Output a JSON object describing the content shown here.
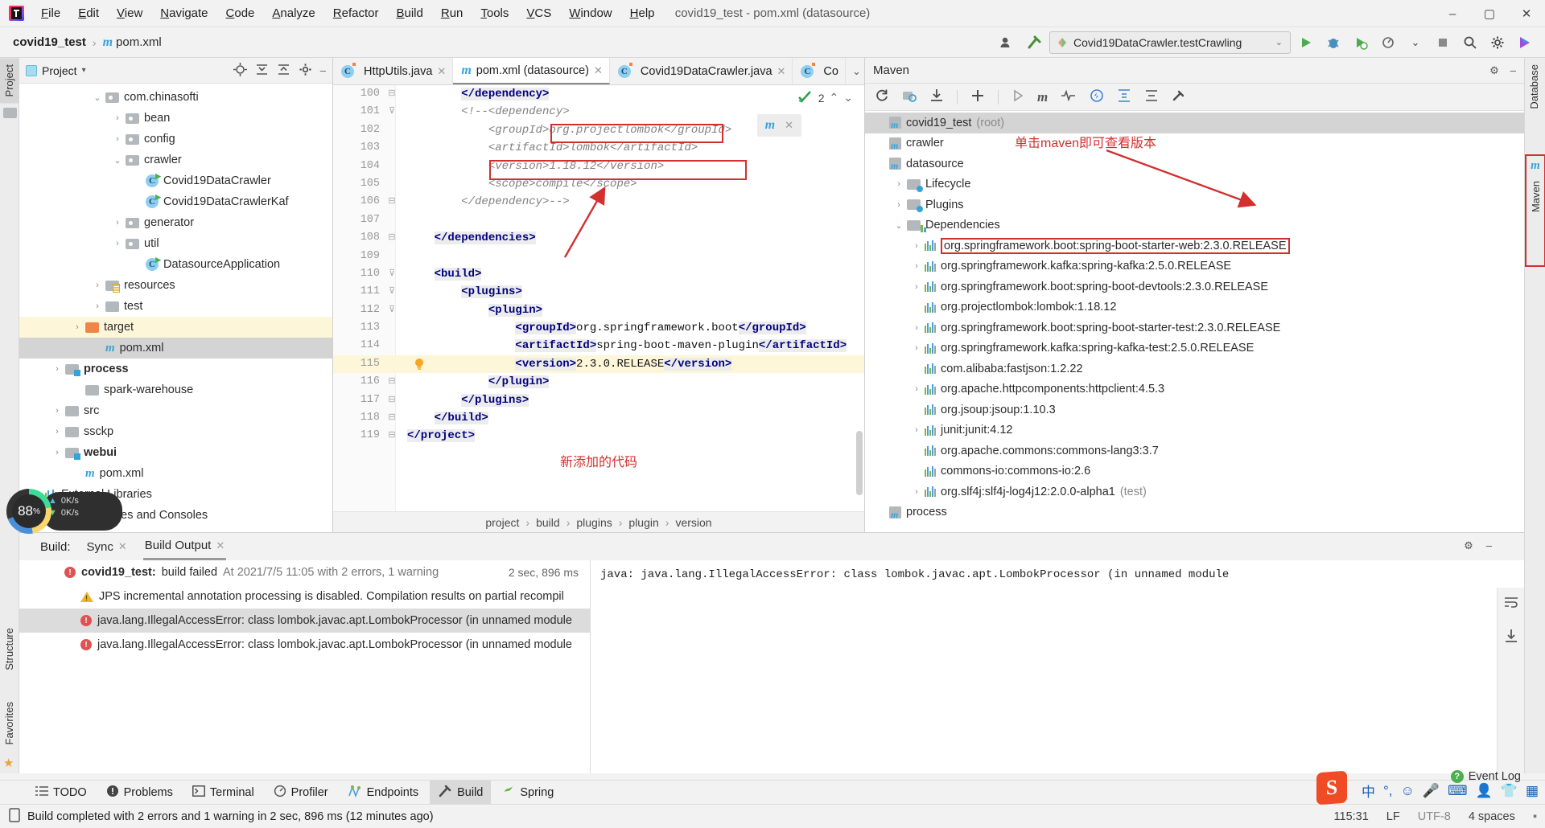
{
  "window": {
    "title": "covid19_test - pom.xml (datasource)",
    "minimize": "–",
    "maximize": "▢",
    "close": "✕"
  },
  "menu": [
    "File",
    "Edit",
    "View",
    "Navigate",
    "Code",
    "Analyze",
    "Refactor",
    "Build",
    "Run",
    "Tools",
    "VCS",
    "Window",
    "Help"
  ],
  "navbar": {
    "project": "covid19_test",
    "separator": "›",
    "file": "pom.xml",
    "run_config": "Covid19DataCrawler.testCrawling",
    "chevron": "⌄"
  },
  "left_strip": {
    "project_tab": "Project",
    "structure_tab": "Structure",
    "favorites_tab": "Favorites"
  },
  "right_strip": {
    "database_tab": "Database",
    "maven_tab": "Maven"
  },
  "project_panel": {
    "title": "Project",
    "dropdown": "▾",
    "tree": [
      {
        "label": "com.chinasofti",
        "type": "folder",
        "arrow": "⌄",
        "indent": 3
      },
      {
        "label": "bean",
        "type": "folder",
        "arrow": "›",
        "indent": 4
      },
      {
        "label": "config",
        "type": "folder",
        "arrow": "›",
        "indent": 4
      },
      {
        "label": "crawler",
        "type": "folder",
        "arrow": "⌄",
        "indent": 4
      },
      {
        "label": "Covid19DataCrawler",
        "type": "class",
        "arrow": "",
        "indent": 5
      },
      {
        "label": "Covid19DataCrawlerKaf",
        "type": "class",
        "arrow": "",
        "indent": 5
      },
      {
        "label": "generator",
        "type": "folder",
        "arrow": "›",
        "indent": 4
      },
      {
        "label": "util",
        "type": "folder",
        "arrow": "›",
        "indent": 4
      },
      {
        "label": "DatasourceApplication",
        "type": "class-app",
        "arrow": "",
        "indent": 5
      },
      {
        "label": "resources",
        "type": "folder-res",
        "arrow": "›",
        "indent": 3
      },
      {
        "label": "test",
        "type": "folder-plain",
        "arrow": "›",
        "indent": 3
      },
      {
        "label": "target",
        "type": "folder-orange",
        "arrow": "›",
        "indent": 2,
        "state": "hl"
      },
      {
        "label": "pom.xml",
        "type": "maven",
        "arrow": "",
        "indent": 3,
        "state": "sel"
      },
      {
        "label": "process",
        "type": "folder-mod",
        "arrow": "›",
        "indent": 1,
        "bold": true
      },
      {
        "label": "spark-warehouse",
        "type": "folder-plain",
        "arrow": "",
        "indent": 2
      },
      {
        "label": "src",
        "type": "folder-plain",
        "arrow": "›",
        "indent": 1
      },
      {
        "label": "ssckp",
        "type": "folder-plain",
        "arrow": "›",
        "indent": 1
      },
      {
        "label": "webui",
        "type": "folder-mod",
        "arrow": "›",
        "indent": 1,
        "bold": true
      },
      {
        "label": "pom.xml",
        "type": "maven",
        "arrow": "",
        "indent": 2
      },
      {
        "label": "External Libraries",
        "type": "bars",
        "arrow": "›",
        "indent": 0
      },
      {
        "label": "Scratches and Consoles",
        "type": "bars",
        "arrow": "",
        "indent": 1
      }
    ]
  },
  "editor": {
    "tabs": [
      {
        "label": "HttpUtils.java",
        "icon": "java-class-icon",
        "active": false,
        "close": "✕"
      },
      {
        "label": "pom.xml (datasource)",
        "icon": "maven-icon",
        "active": true,
        "close": "✕"
      },
      {
        "label": "Covid19DataCrawler.java",
        "icon": "java-class-icon",
        "active": false,
        "close": "✕"
      },
      {
        "label": "Co",
        "icon": "java-class-icon",
        "active": false,
        "close": ""
      }
    ],
    "tab_more": "⌄",
    "inspection": {
      "count": "2",
      "up": "⌃",
      "down": "⌄",
      "icon": "inspection-ok-icon"
    },
    "reimport_hint": "maven-reimport-icon",
    "reimport_close": "✕",
    "lines": [
      {
        "n": "100",
        "fold": "⊟",
        "indent": 4,
        "segs": [
          {
            "t": "</dependency>",
            "c": "tag tag-bg"
          }
        ]
      },
      {
        "n": "101",
        "fold": "⊽",
        "indent": 4,
        "segs": [
          {
            "t": "<!--<dependency>",
            "c": "comm"
          }
        ]
      },
      {
        "n": "102",
        "fold": "",
        "indent": 6,
        "segs": [
          {
            "t": "<groupId>org.projectlombok</groupId>",
            "c": "comm"
          }
        ]
      },
      {
        "n": "103",
        "fold": "",
        "indent": 6,
        "segs": [
          {
            "t": "<artifactId>lombok</artifactId>",
            "c": "comm"
          }
        ]
      },
      {
        "n": "104",
        "fold": "",
        "indent": 6,
        "segs": [
          {
            "t": "<version>1.18.12</version>",
            "c": "comm"
          }
        ]
      },
      {
        "n": "105",
        "fold": "",
        "indent": 6,
        "segs": [
          {
            "t": "<scope>compile</scope>",
            "c": "comm"
          }
        ]
      },
      {
        "n": "106",
        "fold": "⊟",
        "indent": 4,
        "segs": [
          {
            "t": "</dependency>-->",
            "c": "comm"
          }
        ]
      },
      {
        "n": "107",
        "fold": "",
        "indent": 0,
        "segs": []
      },
      {
        "n": "108",
        "fold": "⊟",
        "indent": 2,
        "segs": [
          {
            "t": "</dependencies>",
            "c": "tag tag-bg"
          }
        ]
      },
      {
        "n": "109",
        "fold": "",
        "indent": 0,
        "segs": []
      },
      {
        "n": "110",
        "fold": "⊽",
        "indent": 2,
        "segs": [
          {
            "t": "<build>",
            "c": "tag tag-bg"
          }
        ]
      },
      {
        "n": "111",
        "fold": "⊽",
        "indent": 4,
        "segs": [
          {
            "t": "<plugins>",
            "c": "tag tag-bg"
          }
        ]
      },
      {
        "n": "112",
        "fold": "⊽",
        "indent": 6,
        "segs": [
          {
            "t": "<plugin>",
            "c": "tag tag-bg"
          }
        ]
      },
      {
        "n": "113",
        "fold": "",
        "indent": 8,
        "segs": [
          {
            "t": "<groupId>",
            "c": "tag tag-bg"
          },
          {
            "t": "org.springframework.boot",
            "c": "val"
          },
          {
            "t": "</groupId>",
            "c": "tag tag-bg"
          }
        ]
      },
      {
        "n": "114",
        "fold": "",
        "indent": 8,
        "segs": [
          {
            "t": "<artifactId>",
            "c": "tag tag-bg"
          },
          {
            "t": "spring-boot-maven-plugin",
            "c": "val"
          },
          {
            "t": "</artifactId>",
            "c": "tag tag-bg"
          }
        ]
      },
      {
        "n": "115",
        "fold": "",
        "indent": 8,
        "state": "hl",
        "bulb": true,
        "segs": [
          {
            "t": "<version>",
            "c": "tag tag-bg"
          },
          {
            "t": "2.3.0.RELEASE",
            "c": "val"
          },
          {
            "t": "</version>",
            "c": "tag tag-bg"
          }
        ]
      },
      {
        "n": "116",
        "fold": "⊟",
        "indent": 6,
        "segs": [
          {
            "t": "</plugin>",
            "c": "tag tag-bg"
          }
        ]
      },
      {
        "n": "117",
        "fold": "⊟",
        "indent": 4,
        "segs": [
          {
            "t": "</plugins>",
            "c": "tag tag-bg"
          }
        ]
      },
      {
        "n": "118",
        "fold": "⊟",
        "indent": 2,
        "segs": [
          {
            "t": "</build>",
            "c": "tag tag-bg"
          }
        ]
      },
      {
        "n": "119",
        "fold": "⊟",
        "indent": 0,
        "segs": [
          {
            "t": "</project>",
            "c": "tag tag-bg"
          }
        ]
      }
    ],
    "breadcrumbs": [
      "project",
      "build",
      "plugins",
      "plugin",
      "version"
    ],
    "breadcrumb_sep": "›"
  },
  "annotations": {
    "new_code_label": "新添加的代码",
    "maven_click_label": "单击maven即可查看版本"
  },
  "maven_panel": {
    "title": "Maven",
    "gear": "⚙",
    "minimize": "–",
    "toolbar": [
      "refresh-icon",
      "add-maven-project-icon",
      "download-sources-icon",
      "add-icon",
      "run-icon",
      "execute-goal-icon",
      "toggle-skip-tests-icon",
      "toggle-offline-icon",
      "expand-icon",
      "collapse-icon",
      "settings-icon"
    ],
    "tree": [
      {
        "label": "covid19_test",
        "suffix": "(root)",
        "type": "maven-project",
        "arrow": "",
        "indent": 0,
        "state": "sel"
      },
      {
        "label": "crawler",
        "suffix": "",
        "type": "maven-project",
        "arrow": "",
        "indent": 0
      },
      {
        "label": "datasource",
        "suffix": "",
        "type": "maven-project",
        "arrow": "",
        "indent": 0
      },
      {
        "label": "Lifecycle",
        "suffix": "",
        "type": "lifecycle",
        "arrow": "›",
        "indent": 1
      },
      {
        "label": "Plugins",
        "suffix": "",
        "type": "lifecycle",
        "arrow": "›",
        "indent": 1
      },
      {
        "label": "Dependencies",
        "suffix": "",
        "type": "deps",
        "arrow": "⌄",
        "indent": 1
      },
      {
        "label": "org.springframework.boot:spring-boot-starter-web:2.3.0.RELEASE",
        "suffix": "",
        "type": "dep",
        "arrow": "›",
        "indent": 2,
        "boxed": true
      },
      {
        "label": "org.springframework.kafka:spring-kafka:2.5.0.RELEASE",
        "suffix": "",
        "type": "dep",
        "arrow": "›",
        "indent": 2
      },
      {
        "label": "org.springframework.boot:spring-boot-devtools:2.3.0.RELEASE",
        "suffix": "",
        "type": "dep",
        "arrow": "›",
        "indent": 2
      },
      {
        "label": "org.projectlombok:lombok:1.18.12",
        "suffix": "",
        "type": "dep",
        "arrow": "",
        "indent": 2
      },
      {
        "label": "org.springframework.boot:spring-boot-starter-test:2.3.0.RELEASE",
        "suffix": "",
        "type": "dep",
        "arrow": "›",
        "indent": 2
      },
      {
        "label": "org.springframework.kafka:spring-kafka-test:2.5.0.RELEASE",
        "suffix": "",
        "type": "dep",
        "arrow": "›",
        "indent": 2
      },
      {
        "label": "com.alibaba:fastjson:1.2.22",
        "suffix": "",
        "type": "dep",
        "arrow": "",
        "indent": 2
      },
      {
        "label": "org.apache.httpcomponents:httpclient:4.5.3",
        "suffix": "",
        "type": "dep",
        "arrow": "›",
        "indent": 2
      },
      {
        "label": "org.jsoup:jsoup:1.10.3",
        "suffix": "",
        "type": "dep",
        "arrow": "",
        "indent": 2
      },
      {
        "label": "junit:junit:4.12",
        "suffix": "",
        "type": "dep",
        "arrow": "›",
        "indent": 2
      },
      {
        "label": "org.apache.commons:commons-lang3:3.7",
        "suffix": "",
        "type": "dep",
        "arrow": "",
        "indent": 2
      },
      {
        "label": "commons-io:commons-io:2.6",
        "suffix": "",
        "type": "dep",
        "arrow": "",
        "indent": 2
      },
      {
        "label": "org.slf4j:slf4j-log4j12:2.0.0-alpha1",
        "suffix": "(test)",
        "type": "dep",
        "arrow": "›",
        "indent": 2
      },
      {
        "label": "process",
        "suffix": "",
        "type": "maven-project",
        "arrow": "",
        "indent": 0
      }
    ]
  },
  "build_panel": {
    "label": "Build:",
    "tabs": [
      {
        "label": "Sync",
        "close": "✕",
        "active": false
      },
      {
        "label": "Build Output",
        "close": "✕",
        "active": true
      }
    ],
    "gear": "⚙",
    "minimize": "–",
    "rows": [
      {
        "icon": "error",
        "bold": "covid19_test:",
        "text": " build failed",
        "muted": " At 2021/7/5 11:05 with 2 errors, 1 warning",
        "time": "2 sec, 896 ms",
        "level": 1
      },
      {
        "icon": "warning",
        "bold": "",
        "text": "JPS incremental annotation processing is disabled. Compilation results on partial recompil",
        "muted": "",
        "time": "",
        "level": 2
      },
      {
        "icon": "error",
        "bold": "",
        "text": "java.lang.IllegalAccessError: class lombok.javac.apt.LombokProcessor (in unnamed module",
        "muted": "",
        "time": "",
        "level": 2,
        "state": "sel"
      },
      {
        "icon": "error",
        "bold": "",
        "text": "java.lang.IllegalAccessError: class lombok.javac.apt.LombokProcessor (in unnamed module",
        "muted": "",
        "time": "",
        "level": 2
      }
    ],
    "console": "java: java.lang.IllegalAccessError: class lombok.javac.apt.LombokProcessor (in unnamed module"
  },
  "bottom_bar": [
    {
      "label": "TODO",
      "icon": "todo-icon",
      "active": false
    },
    {
      "label": "Problems",
      "icon": "problems-icon",
      "active": false
    },
    {
      "label": "Terminal",
      "icon": "terminal-icon",
      "active": false
    },
    {
      "label": "Profiler",
      "icon": "profiler-icon",
      "active": false
    },
    {
      "label": "Endpoints",
      "icon": "endpoints-icon",
      "active": false
    },
    {
      "label": "Build",
      "icon": "build-icon",
      "active": true
    },
    {
      "label": "Spring",
      "icon": "spring-icon",
      "active": false
    }
  ],
  "status_bar": {
    "icon": "status-doc-icon",
    "message": "Build completed with 2 errors and 1 warning in 2 sec, 896 ms (12 minutes ago)",
    "caret": "115:31",
    "line_separator": "LF",
    "encoding": "UTF-8",
    "indent": "4 spaces",
    "event_log": "Event Log",
    "event_log_badge": "?"
  },
  "widgets": {
    "cpu_percent": "88",
    "cpu_unit": "%",
    "net_up": "0K/s",
    "net_down": "0K/s",
    "ime_letter": "S",
    "ime_lang": "中",
    "tray_icons": [
      "temperature-icon",
      "emoji-icon",
      "mic-icon",
      "keyboard-icon",
      "user-card-icon",
      "skin-icon",
      "apps-icon"
    ]
  },
  "colors": {
    "accent_red": "#d32f2f",
    "highlight_yellow": "#fdf6d8",
    "selection_grey": "#d4d4d4",
    "tag_blue": "#000080",
    "maven_blue": "#35a4d8",
    "error_red": "#e05252",
    "warn_amber": "#f0b429",
    "run_green": "#4dab4d"
  }
}
